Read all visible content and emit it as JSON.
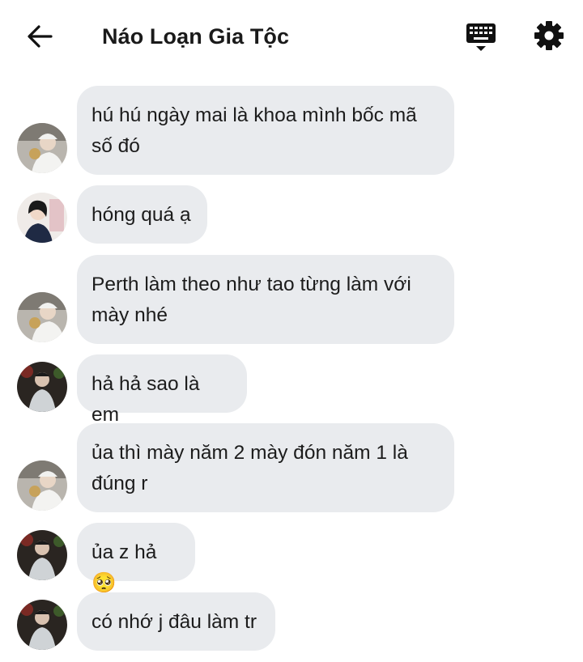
{
  "header": {
    "title": "Náo Loạn Gia Tộc",
    "back_icon": "arrow-left-icon",
    "keyboard_icon": "keyboard-icon",
    "settings_icon": "gear-icon"
  },
  "messages": [
    {
      "sender": "user-a",
      "text": "hú hú ngày mai là khoa mình bốc mã số đó"
    },
    {
      "sender": "user-b",
      "text": "hóng quá ạ"
    },
    {
      "sender": "user-a",
      "text": "Perth làm theo như tao từng làm với mày nhé"
    },
    {
      "sender": "user-c",
      "text": "hả hả sao là em"
    },
    {
      "sender": "user-a",
      "text": "ủa thì mày năm 2 mày đón năm 1 là đúng r"
    },
    {
      "sender": "user-c",
      "text": "ủa z hả🥺"
    },
    {
      "sender": "user-c",
      "text": "có nhớ j đâu làm tr"
    }
  ],
  "colors": {
    "bubble": "#e9ebee",
    "text": "#1c1c1c",
    "background": "#ffffff"
  }
}
